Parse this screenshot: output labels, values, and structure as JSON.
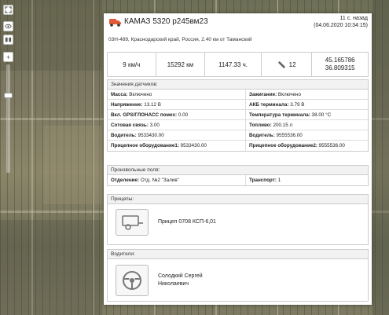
{
  "vehicle": {
    "name": "КАМАЗ 5320 р245вм23",
    "updated_ago": "11 с. назад",
    "updated_at": "(04.06.2020 10:34:15)",
    "address": "03Н-489, Краснодарский край, Россия, 2.40 км от Таманский"
  },
  "metrics": {
    "speed": "9 км/ч",
    "mileage": "15292 км",
    "engine_hours": "1147.33 ч.",
    "satellites": "12",
    "lat": "45.165786",
    "lon": "36.809315"
  },
  "sensors": {
    "title": "Значения датчиков:",
    "rows": [
      [
        {
          "label": "Масса:",
          "value": " Включено"
        },
        {
          "label": "Зажигание:",
          "value": " Включено"
        }
      ],
      [
        {
          "label": "Напряжение:",
          "value": " 13.12 В"
        },
        {
          "label": "АКБ терминала:",
          "value": " 3.79 В"
        }
      ],
      [
        {
          "label": "Вкл. GPS/ГЛОНАСС помех:",
          "value": " 0.00"
        },
        {
          "label": "Температура терминала:",
          "value": " 38.00 °C"
        }
      ],
      [
        {
          "label": "Сотовая связь:",
          "value": " 3.00"
        },
        {
          "label": "Топливо:",
          "value": " 200.15 л"
        }
      ],
      [
        {
          "label": "Водитель:",
          "value": " 9533430.00"
        },
        {
          "label": "Водитель:",
          "value": " 9555536.00"
        }
      ],
      [
        {
          "label": "Прицепное оборудование1:",
          "value": " 9533430.00"
        },
        {
          "label": "Прицепное оборудование2:",
          "value": " 9555536.00"
        }
      ]
    ]
  },
  "custom_fields": {
    "title": "Произвольные поля:",
    "rows": [
      [
        {
          "label": "Отделение:",
          "value": " Отд. №2 \"Залив\""
        },
        {
          "label": "Транспорт:",
          "value": " 1"
        }
      ]
    ]
  },
  "trailers": {
    "title": "Прицепы:",
    "name": "Прицеп 0708 КСП-6,01"
  },
  "drivers": {
    "title": "Водители:",
    "name_line1": "Солодкий Сергей",
    "name_line2": "Николаевич"
  },
  "map_controls": {
    "zoom_in": "+",
    "zoom_out": "−"
  }
}
